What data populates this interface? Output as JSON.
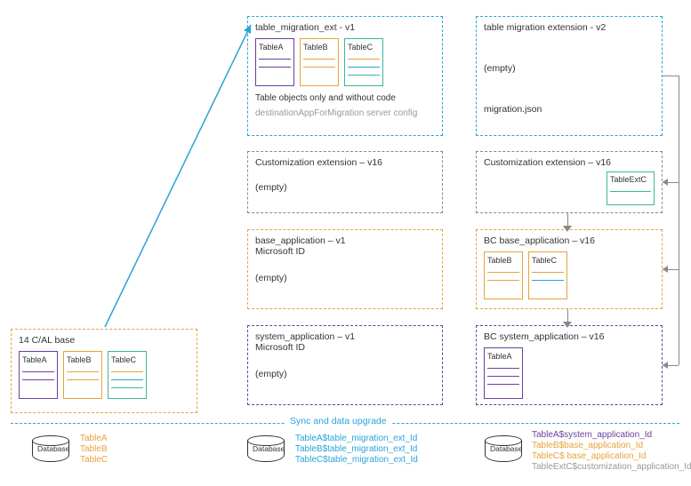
{
  "col1": {
    "cal": {
      "title": "14 C/AL base",
      "tables": [
        "TableA",
        "TableB",
        "TableC"
      ]
    }
  },
  "col2": {
    "migV1": {
      "title": "table_migration_ext - v1",
      "tables": [
        "TableA",
        "TableB",
        "TableC"
      ],
      "caption": "Table objects only and without code",
      "note": "destinationAppForMigration server config"
    },
    "cust": {
      "title": "Customization extension – v16",
      "body": "(empty)"
    },
    "base": {
      "title": "base_application – v1",
      "sub": "Microsoft ID",
      "body": "(empty)"
    },
    "sys": {
      "title": "system_application – v1",
      "sub": "Microsoft ID",
      "body": "(empty)"
    }
  },
  "col3": {
    "migV2": {
      "title": "table migration extension - v2",
      "body": "(empty)",
      "note": "migration.json"
    },
    "cust": {
      "title": "Customization extension – v16",
      "tableExt": "TableExtC"
    },
    "base": {
      "title": "BC base_application – v16",
      "tables": [
        "TableB",
        "TableC"
      ]
    },
    "sys": {
      "title": "BC system_application – v16",
      "tables": [
        "TableA"
      ]
    }
  },
  "sync": {
    "label": "Sync and data upgrade"
  },
  "db": {
    "label": "Database",
    "d1": [
      "TableA",
      "TableB",
      "TableC"
    ],
    "d2": [
      "TableA$table_migration_ext_Id",
      "TableB$table_migration_ext_Id",
      "TableC$table_migration_ext_Id"
    ],
    "d3": [
      "TableA$system_application_Id",
      "TableB$base_application_Id",
      "TableC$ base_application_Id",
      "TableExtC$customization_application_Id"
    ]
  }
}
